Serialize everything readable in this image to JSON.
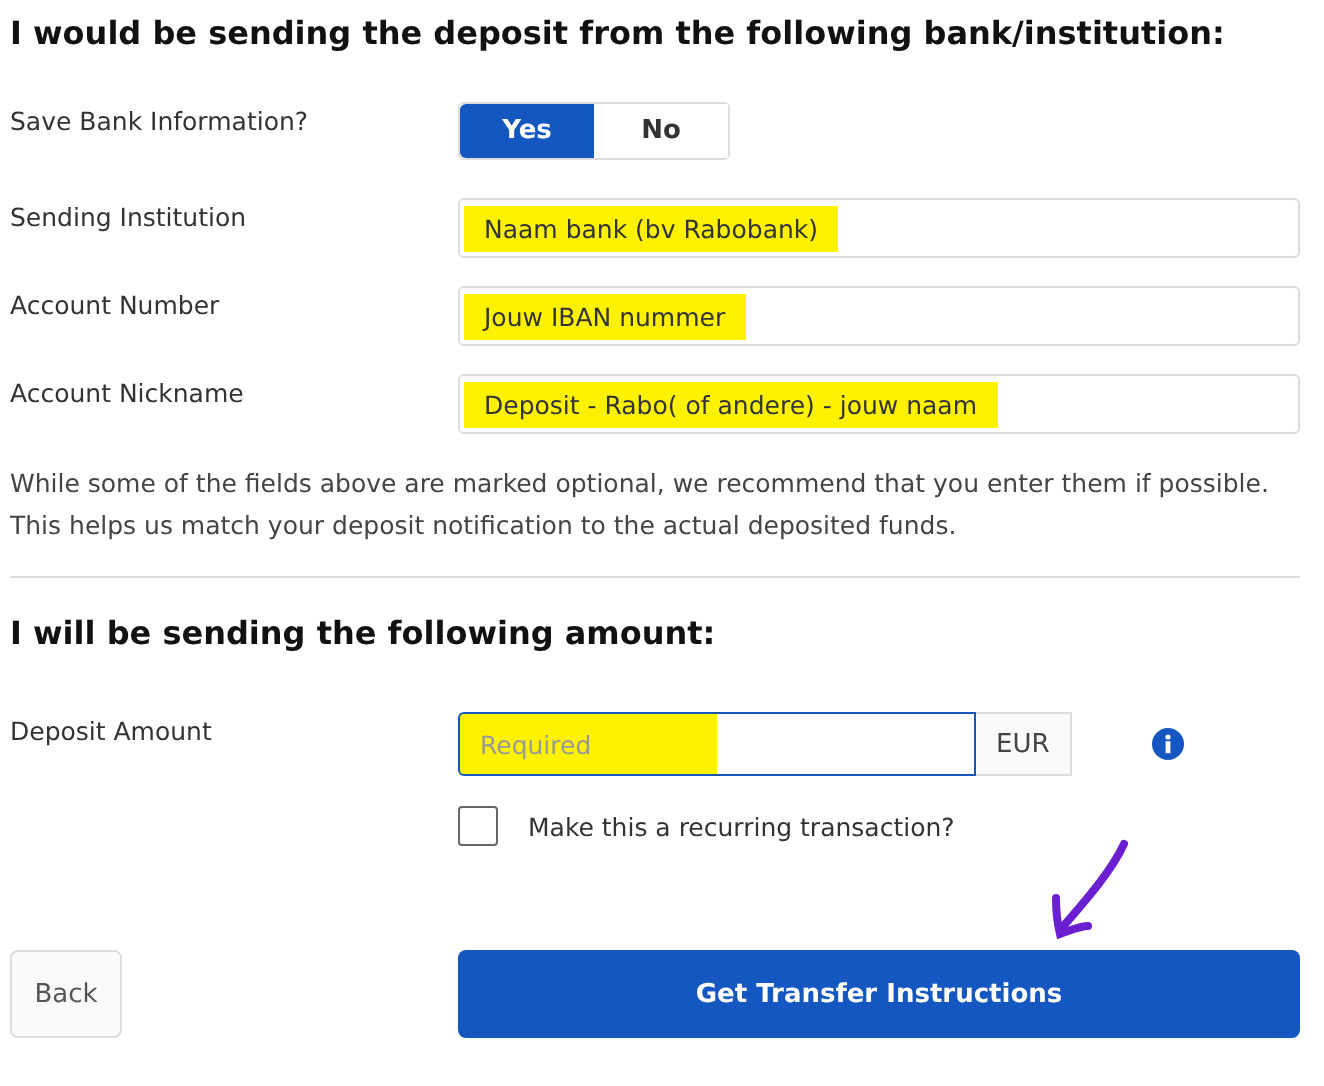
{
  "bank_section": {
    "heading": "I would be sending the deposit from the following bank/institution:",
    "save_bank_info": {
      "label": "Save Bank Information?",
      "options": [
        {
          "label": "Yes",
          "selected": true
        },
        {
          "label": "No",
          "selected": false
        }
      ]
    },
    "fields": [
      {
        "label": "Sending Institution",
        "value": "Naam bank (bv Rabobank)",
        "highlighted": true
      },
      {
        "label": "Account Number",
        "value": "Jouw IBAN nummer",
        "highlighted": true
      },
      {
        "label": "Account Nickname",
        "value": "Deposit - Rabo( of andere) - jouw naam",
        "highlighted": true
      }
    ],
    "note": "While some of the fields above are marked optional, we recommend that you enter them if possible. This helps us match your deposit notification to the actual deposited funds."
  },
  "amount_section": {
    "heading": "I will be sending the following amount:",
    "deposit_amount": {
      "label": "Deposit Amount",
      "placeholder": "Required",
      "currency": "EUR",
      "focused": true,
      "highlighted": true
    },
    "recurring": {
      "label": "Make this a recurring transaction?",
      "checked": false
    }
  },
  "buttons": {
    "back": "Back",
    "submit": "Get Transfer Instructions"
  }
}
